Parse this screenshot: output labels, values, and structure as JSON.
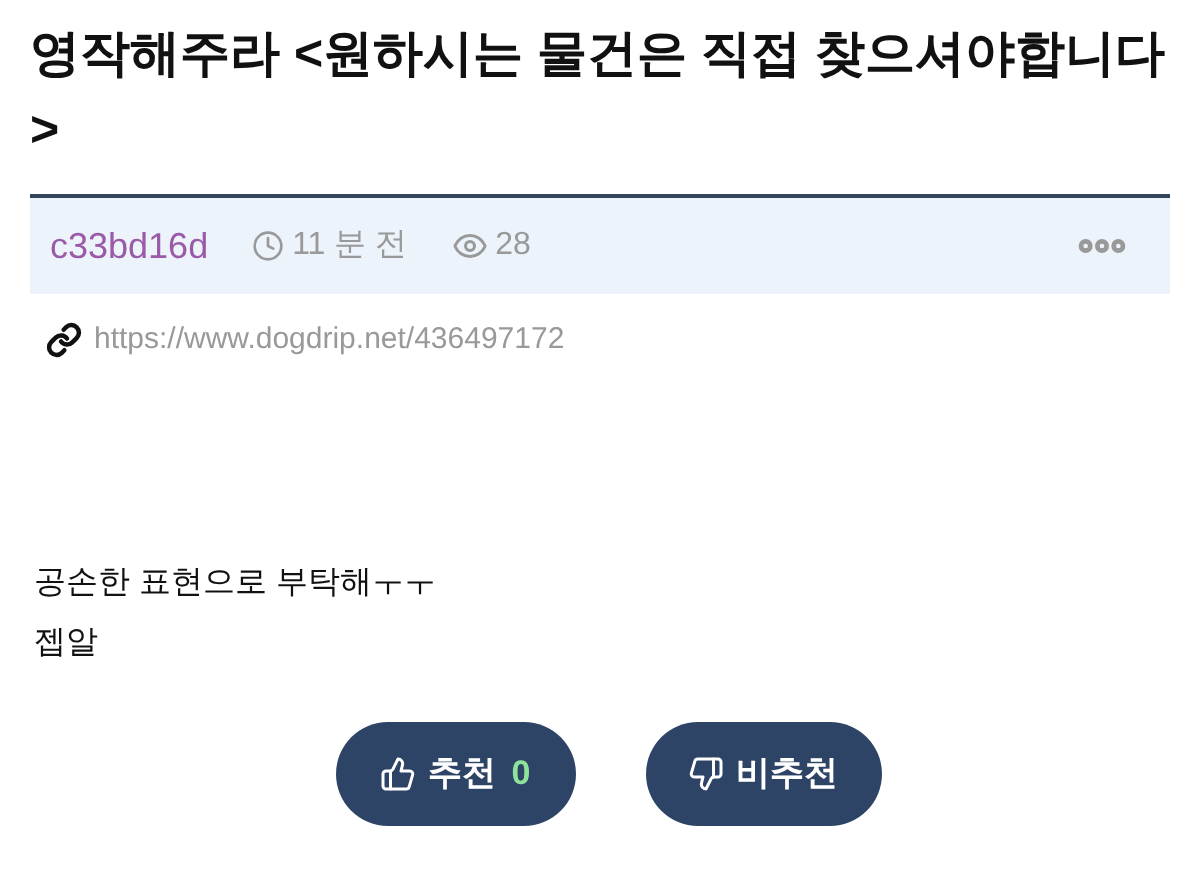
{
  "post": {
    "title": "영작해주라 <원하시는 물건은 직접 찾으셔야합니다>",
    "author": "c33bd16d",
    "time": "11 분 전",
    "views": "28",
    "url": "https://www.dogdrip.net/436497172",
    "body": [
      "공손한 표현으로 부탁해ㅜㅜ",
      "젭알"
    ]
  },
  "votes": {
    "up_label": "추천",
    "up_count": "0",
    "down_label": "비추천"
  }
}
